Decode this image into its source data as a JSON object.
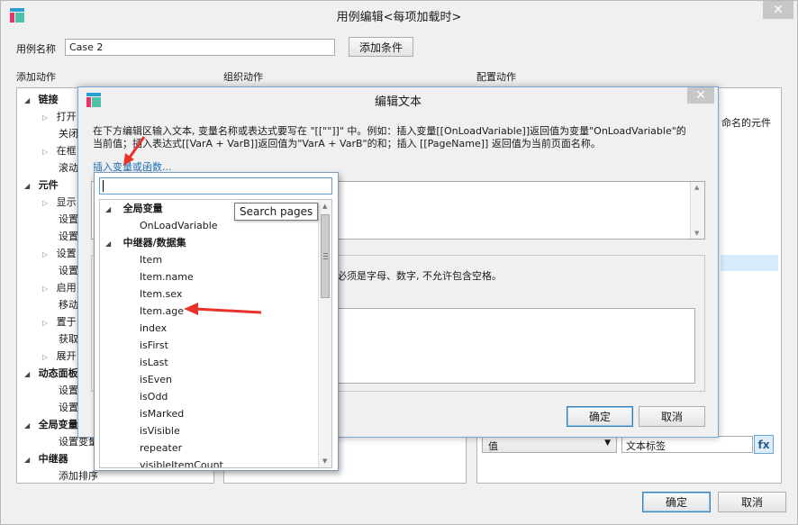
{
  "outer": {
    "title": "用例编辑<每项加载时>",
    "close_label": "✕",
    "case_name_label": "用例名称",
    "case_name_value": "Case 2",
    "add_condition": "添加条件",
    "col_add_action": "添加动作",
    "col_organize_action": "组织动作",
    "col_config_action": "配置动作",
    "ok": "确定",
    "cancel": "取消"
  },
  "tree": {
    "links": "链接",
    "open": "打开",
    "close": "关闭",
    "in_frame": "在框",
    "scroll": "滚动",
    "widgets": "元件",
    "show": "显示",
    "set1": "设置",
    "set2": "设置",
    "set3": "设置",
    "set4": "设置",
    "enable": "启用",
    "move": "移动",
    "bring": "置于",
    "get": "获取",
    "expand": "展开",
    "dynamic_panel": "动态面板",
    "dp_set1": "设置",
    "dp_set2": "设置",
    "global_var": "全局变量",
    "set_var": "设置变量",
    "repeater": "中继器",
    "add_sort": "添加排序"
  },
  "config": {
    "named_widget": "命名的元件",
    "value_select": "值",
    "text_label": "文本标签",
    "fx": "fx"
  },
  "dialog": {
    "title": "编辑文本",
    "close_label": "✕",
    "desc_line1": "在下方编辑区输入文本, 变量名称或表达式要写在 \"[[\"\"]]\" 中。例如：插入变量[[OnLoadVariable]]返回值为变量\"OnLoadVariable\"的",
    "desc_line2": "当前值；插入表达式[[VarA + VarB]]返回值为\"VarA + VarB\"的和；插入 [[PageName]] 返回值为当前页面名称。",
    "insert_link": "插入变量或函数...",
    "local_var_note": "必须是字母、数字, 不允许包含空格。",
    "ok": "确定",
    "cancel": "取消"
  },
  "popup": {
    "search_value": "",
    "tooltip": "Search pages",
    "group_global": "全局变量",
    "onload": "OnLoadVariable",
    "group_repeater": "中继器/数据集",
    "items": [
      "Item",
      "Item.name",
      "Item.sex",
      "Item.age",
      "index",
      "isFirst",
      "isLast",
      "isEven",
      "isOdd",
      "isMarked",
      "isVisible",
      "repeater",
      "visibleItemCount"
    ]
  },
  "colors": {
    "accent": "#2a9fd6",
    "arrow": "#e8322a",
    "link": "#1b6db3",
    "selected_row": "#d9ecfb"
  }
}
